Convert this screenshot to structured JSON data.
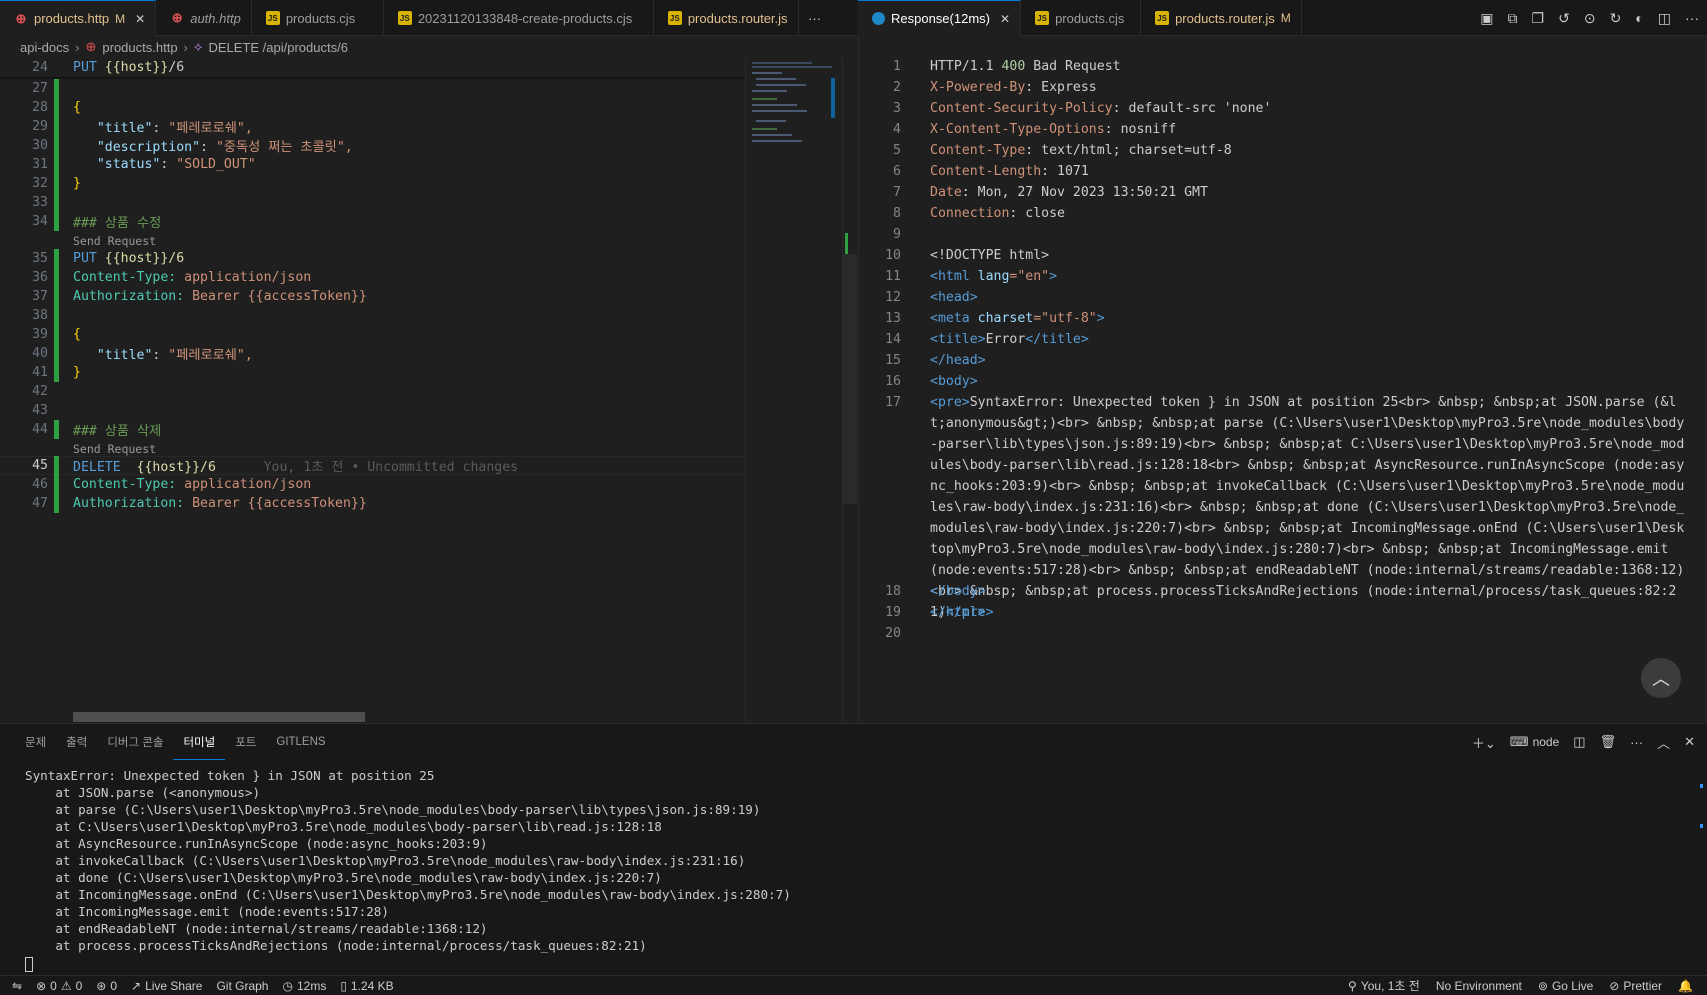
{
  "left_tabs": [
    {
      "icon": "http",
      "label": "products.http",
      "badge": "M",
      "active": true,
      "close": "✕"
    },
    {
      "icon": "http",
      "label": "auth.http",
      "italic": true
    },
    {
      "icon": "js",
      "label": "products.cjs"
    },
    {
      "icon": "js",
      "label": "20231120133848-create-products.cjs"
    },
    {
      "icon": "js",
      "label": "products.router.js",
      "yellow": true
    }
  ],
  "right_tabs": [
    {
      "icon": "resp",
      "label": "Response(12ms)",
      "active": true,
      "close": "✕"
    },
    {
      "icon": "js",
      "label": "products.cjs"
    },
    {
      "icon": "js",
      "label": "products.router.js",
      "badge": "M",
      "yellow": true
    }
  ],
  "more": "···",
  "breadcrumb": {
    "root": "api-docs",
    "file": "products.http",
    "symbol": "DELETE /api/products/6"
  },
  "editor_left": {
    "sticky": {
      "num": "24",
      "method": "PUT",
      "url_pre": "{{host}}",
      "url_post": "/6"
    },
    "codelens_1": "Send Request",
    "codelens_2": "Send Request",
    "blame": "You, 1초 전 • Uncommitted changes",
    "lines": [
      {
        "num": "27",
        "text": ""
      },
      {
        "num": "28",
        "text": "{"
      },
      {
        "num": "29",
        "key": "\"title\"",
        "val": "\"페레로로쉐\","
      },
      {
        "num": "30",
        "key": "\"description\"",
        "val": "\"중독성 쩌는 초콜릿\","
      },
      {
        "num": "31",
        "key": "\"status\"",
        "val": "\"SOLD_OUT\""
      },
      {
        "num": "32",
        "text": "}"
      },
      {
        "num": "33",
        "text": ""
      },
      {
        "num": "34",
        "comment": "### 상품 수정"
      },
      {
        "num": "35",
        "method": "PUT",
        "url": "{{host}}/6"
      },
      {
        "num": "36",
        "hname": "Content-Type:",
        "hval": "application/json"
      },
      {
        "num": "37",
        "hname": "Authorization:",
        "hval": "Bearer {{accessToken}}"
      },
      {
        "num": "38",
        "text": ""
      },
      {
        "num": "39",
        "text": "{"
      },
      {
        "num": "40",
        "key": "\"title\"",
        "val": "\"페레로로쉐\","
      },
      {
        "num": "41",
        "text": "}"
      },
      {
        "num": "42",
        "text": ""
      },
      {
        "num": "43",
        "text": ""
      },
      {
        "num": "44",
        "comment": "### 상품 삭제"
      },
      {
        "num": "45",
        "method": "DELETE",
        "url": " {{host}}/6"
      },
      {
        "num": "46",
        "hname": "Content-Type:",
        "hval": "application/json"
      },
      {
        "num": "47",
        "hname": "Authorization:",
        "hval": "Bearer {{accessToken}}"
      }
    ]
  },
  "response": {
    "status_line": {
      "proto": "HTTP/1.1",
      "code": "400",
      "reason": "Bad Request"
    },
    "headers": [
      {
        "name": "X-Powered-By",
        "value": "Express"
      },
      {
        "name": "Content-Security-Policy",
        "value": "default-src 'none'"
      },
      {
        "name": "X-Content-Type-Options",
        "value": "nosniff"
      },
      {
        "name": "Content-Type",
        "value": "text/html; charset=utf-8"
      },
      {
        "name": "Content-Length",
        "value": "1071"
      },
      {
        "name": "Date",
        "value": "Mon, 27 Nov 2023 13:50:21 GMT"
      },
      {
        "name": "Connection",
        "value": "close"
      }
    ],
    "doctype": "<!DOCTYPE html>",
    "html_open_tag": "<html",
    "lang_attr": "lang",
    "lang_val": "=\"en\"",
    "gt": ">",
    "head_open": "<head>",
    "meta_tag": "<meta",
    "charset_attr": "charset",
    "charset_val": "=\"utf-8\"",
    "title_open": "<title>",
    "title_text": "Error",
    "title_close": "</title>",
    "head_close": "</head>",
    "body_open": "<body>",
    "pre_open": "<pre>",
    "pre_content": "SyntaxError: Unexpected token } in JSON at position 25<br> &nbsp; &nbsp;at JSON.parse (&lt;anonymous&gt;)<br> &nbsp; &nbsp;at parse (C:\\Users\\user1\\Desktop\\myPro3.5re\\node_modules\\body-parser\\lib\\types\\json.js:89:19)<br> &nbsp; &nbsp;at C:\\Users\\user1\\Desktop\\myPro3.5re\\node_modules\\body-parser\\lib\\read.js:128:18<br> &nbsp; &nbsp;at AsyncResource.runInAsyncScope (node:async_hooks:203:9)<br> &nbsp; &nbsp;at invokeCallback (C:\\Users\\user1\\Desktop\\myPro3.5re\\node_modules\\raw-body\\index.js:231:16)<br> &nbsp; &nbsp;at done (C:\\Users\\user1\\Desktop\\myPro3.5re\\node_modules\\raw-body\\index.js:220:7)<br> &nbsp; &nbsp;at IncomingMessage.onEnd (C:\\Users\\user1\\Desktop\\myPro3.5re\\node_modules\\raw-body\\index.js:280:7)<br> &nbsp; &nbsp;at IncomingMessage.emit (node:events:517:28)<br> &nbsp; &nbsp;at endReadableNT (node:internal/streams/readable:1368:12)<br> &nbsp; &nbsp;at process.processTicksAndRejections (node:internal/process/task_queues:82:21)",
    "pre_close": "</pre>",
    "body_close": "</body>",
    "html_close": "</html>",
    "line_numbers": [
      "1",
      "2",
      "3",
      "4",
      "5",
      "6",
      "7",
      "8",
      "9",
      "10",
      "11",
      "12",
      "13",
      "14",
      "15",
      "16",
      "17",
      "18",
      "19",
      "20"
    ]
  },
  "panel": {
    "tabs": [
      "문제",
      "출력",
      "디버그 콘솔",
      "터미널",
      "포트",
      "GITLENS"
    ],
    "active_tab": "터미널",
    "shell": "node",
    "terminal_lines": [
      "SyntaxError: Unexpected token } in JSON at position 25",
      "    at JSON.parse (<anonymous>)",
      "    at parse (C:\\Users\\user1\\Desktop\\myPro3.5re\\node_modules\\body-parser\\lib\\types\\json.js:89:19)",
      "    at C:\\Users\\user1\\Desktop\\myPro3.5re\\node_modules\\body-parser\\lib\\read.js:128:18",
      "    at AsyncResource.runInAsyncScope (node:async_hooks:203:9)",
      "    at invokeCallback (C:\\Users\\user1\\Desktop\\myPro3.5re\\node_modules\\raw-body\\index.js:231:16)",
      "    at done (C:\\Users\\user1\\Desktop\\myPro3.5re\\node_modules\\raw-body\\index.js:220:7)",
      "    at IncomingMessage.onEnd (C:\\Users\\user1\\Desktop\\myPro3.5re\\node_modules\\raw-body\\index.js:280:7)",
      "    at IncomingMessage.emit (node:events:517:28)",
      "    at endReadableNT (node:internal/streams/readable:1368:12)",
      "    at process.processTicksAndRejections (node:internal/process/task_queues:82:21)"
    ]
  },
  "statusbar": {
    "errors": "0",
    "warnings": "0",
    "ports": "0",
    "live_share": "Live Share",
    "git_graph": "Git Graph",
    "timing": "12ms",
    "size": "1.24 KB",
    "blame": "You, 1초 전",
    "environment": "No Environment",
    "go_live": "Go Live",
    "prettier": "Prettier"
  }
}
